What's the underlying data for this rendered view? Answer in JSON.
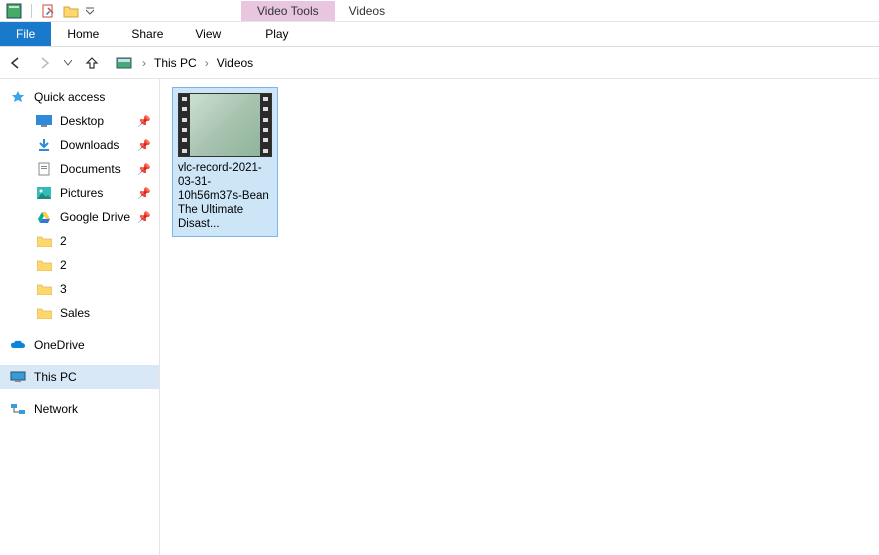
{
  "titlebar": {
    "contextual_tab": "Video Tools",
    "title": "Videos"
  },
  "ribbon": {
    "file": "File",
    "home": "Home",
    "share": "Share",
    "view": "View",
    "play": "Play"
  },
  "address": {
    "crumb1": "This PC",
    "crumb2": "Videos"
  },
  "sidebar": {
    "quick_access": "Quick access",
    "items": [
      {
        "label": "Desktop"
      },
      {
        "label": "Downloads"
      },
      {
        "label": "Documents"
      },
      {
        "label": "Pictures"
      },
      {
        "label": "Google Drive"
      },
      {
        "label": "2"
      },
      {
        "label": "2"
      },
      {
        "label": "3"
      },
      {
        "label": "Sales"
      }
    ],
    "onedrive": "OneDrive",
    "this_pc": "This PC",
    "network": "Network"
  },
  "files": [
    {
      "name": "vlc-record-2021-03-31-10h56m37s-Bean The Ultimate Disast..."
    }
  ]
}
